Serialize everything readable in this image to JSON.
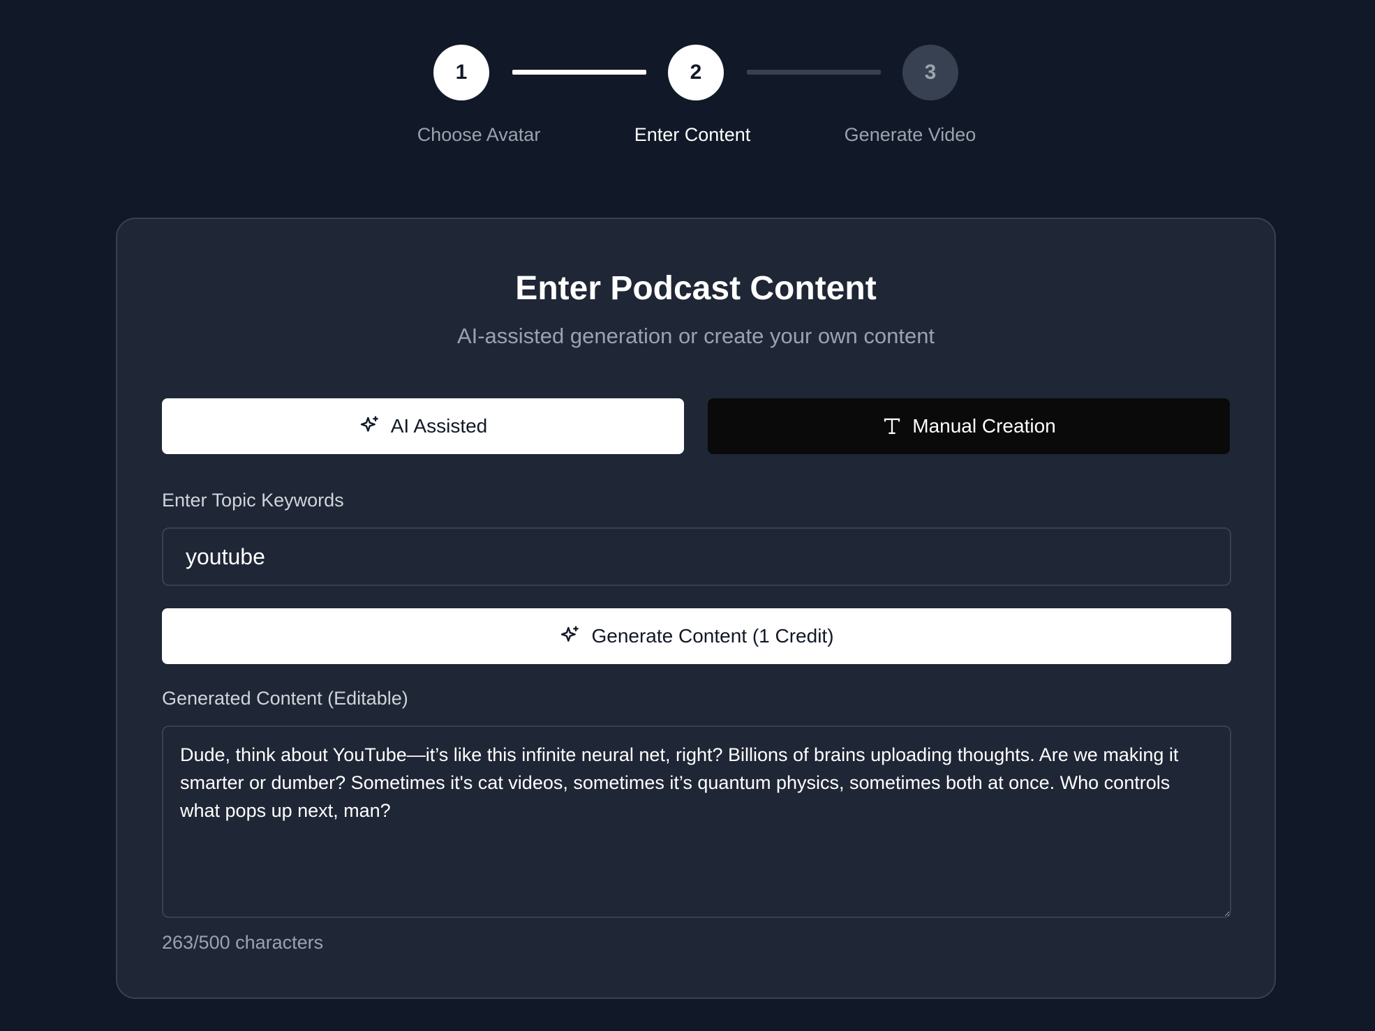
{
  "stepper": {
    "steps": [
      {
        "number": "1",
        "label": "Choose Avatar",
        "state": "done"
      },
      {
        "number": "2",
        "label": "Enter Content",
        "state": "active"
      },
      {
        "number": "3",
        "label": "Generate Video",
        "state": "pending"
      }
    ]
  },
  "card": {
    "title": "Enter Podcast Content",
    "subtitle": "AI-assisted generation or create your own content"
  },
  "mode": {
    "ai_label": "AI Assisted",
    "manual_label": "Manual Creation",
    "selected": "ai"
  },
  "topic": {
    "label": "Enter Topic Keywords",
    "value": "youtube"
  },
  "generate": {
    "label": "Generate Content (1 Credit)"
  },
  "content": {
    "label": "Generated Content (Editable)",
    "value": "Dude, think about YouTube—it’s like this infinite neural net, right? Billions of brains uploading thoughts. Are we making it smarter or dumber? Sometimes it's cat videos, sometimes it’s quantum physics, sometimes both at once. Who controls what pops up next, man?",
    "char_count": "263/500 characters"
  },
  "icons": {
    "ai": "sparkles-icon",
    "manual": "type-icon",
    "generate": "sparkles-icon"
  }
}
